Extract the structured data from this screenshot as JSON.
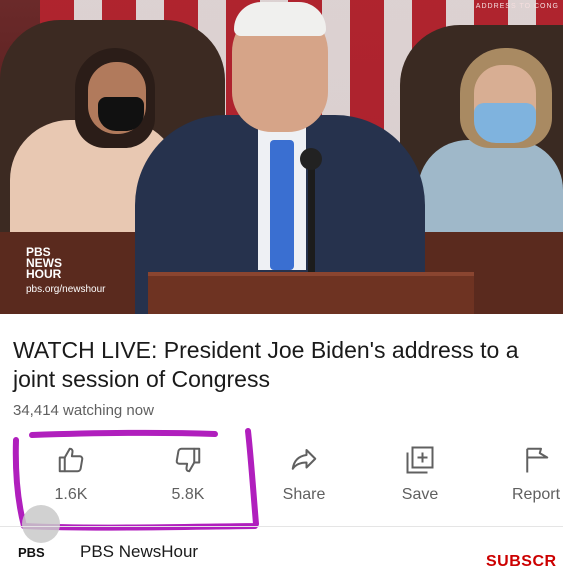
{
  "video": {
    "corner_caption": "ADDRESS TO CONG",
    "logo_lines": [
      "PBS",
      "NEWS",
      "HOUR"
    ],
    "url": "pbs.org/newshour"
  },
  "title": "WATCH LIVE: President Joe Biden's address to a joint session of Congress",
  "watching": "34,414 watching now",
  "actions": {
    "like": {
      "label": "1.6K",
      "icon": "thumbs-up-icon"
    },
    "dislike": {
      "label": "5.8K",
      "icon": "thumbs-down-icon"
    },
    "share": {
      "label": "Share",
      "icon": "share-arrow-icon"
    },
    "save": {
      "label": "Save",
      "icon": "playlist-add-icon"
    },
    "report": {
      "label": "Report",
      "icon": "flag-icon"
    }
  },
  "annotation_color": "#b01fbd",
  "channel": {
    "logo": "PBS",
    "name": "PBS NewsHour",
    "subscribe_label": "SUBSCR"
  }
}
